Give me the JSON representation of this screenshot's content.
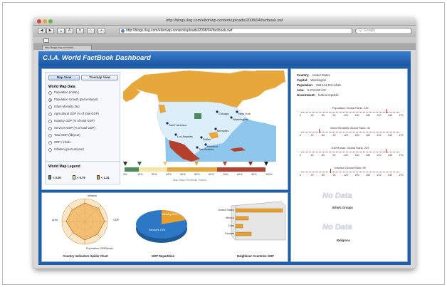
{
  "window": {
    "title": "http://blogs.ilog.com/elixir/wp-content/uploads/2008/04/factbook.swf",
    "url": "http://blogs.ilog.com/elixir/wp-content/uploads/2008/04/factbook.swf",
    "search_placeholder": "Google",
    "tab_label": "http://blogs.ilog.com/elixir/..."
  },
  "dashboard": {
    "title": "C.I.A. World FactBook Dashboard"
  },
  "controls": {
    "view_buttons": [
      "Map View",
      "Treemap View"
    ],
    "map_data_heading": "World Map Data",
    "map_data_options": [
      "Population (inhab.)",
      "Population Growth (percent/year)",
      "Infant Mortality (‰)",
      "Agricultural GDP (% of total GDP)",
      "Industry GDP (% of total GDP)",
      "Services GDP (% of total GDP)",
      "Total GDP (k$/year)",
      "GDP / inhab.",
      "Inflation (percent/year)"
    ],
    "selected_option": 1,
    "legend_heading": "World Map Legend",
    "legend_items": [
      {
        "label": "< 0.00",
        "color": "#3e8a4a"
      },
      {
        "label": "< 0.79",
        "color": "#f2e3a2"
      },
      {
        "label": "< 1.31",
        "color": "#e6a230"
      }
    ]
  },
  "map": {
    "city_labels": [
      "Chicago",
      "New York",
      "Washington",
      "San Francisco",
      "Memphis",
      "Los Angeles",
      "Dallas",
      "Houston",
      "San Antonio"
    ],
    "scale_ticks": [
      "0%",
      "10%",
      "20%",
      "30%",
      "40%",
      "50%",
      "60%",
      "70%",
      "80%",
      "90%",
      "100%"
    ],
    "scale_caption": "Map Data Percentile Portion",
    "colors": {
      "green": "#4b8d5a",
      "yellow": "#f4e7a6",
      "orange": "#e8a73a",
      "red": "#b5412d",
      "water": "#8fc7ec",
      "usa": "#dceef9"
    }
  },
  "charts": {
    "spider": {
      "title": "Country Indicators Spider Chart",
      "labels": [
        "Inflation",
        "GDP",
        "Population GDP/inhab.",
        "Area"
      ]
    },
    "pie": {
      "title": "GDP Repartition",
      "slices": [
        {
          "label": "Industry 20%",
          "value": 20,
          "color": "#e7a02f"
        },
        {
          "label": "Services 79%",
          "value": 79,
          "color": "#2c78c4"
        }
      ]
    },
    "bars": {
      "title": "Neighbour Countries GDP",
      "categories": [
        "United States",
        "Mexico",
        "Cuba",
        "Canada"
      ]
    }
  },
  "info": {
    "fields": [
      {
        "label": "Country:",
        "value": "United States"
      },
      {
        "label": "Capital:",
        "value": "Washington"
      },
      {
        "label": "Population:",
        "value": "298,444,215 inhab."
      },
      {
        "label": "Area:",
        "value": "9,372,610 km²"
      },
      {
        "label": "Government:",
        "value": "federal republic"
      }
    ],
    "ranks": [
      {
        "title": "Population Global Rank: 233",
        "position": 0.87
      },
      {
        "title": "Infant Mortality Global Rank: 40",
        "position": 0.18
      },
      {
        "title": "GDP/Inhab. Global Rank: 229",
        "position": 0.86
      },
      {
        "title": "Inflation Global Rank: 69",
        "position": 0.3
      }
    ],
    "rank_axis": [
      "0",
      "30",
      "60",
      "90",
      "120",
      "150",
      "180",
      "210",
      "240",
      "270"
    ],
    "nodata_text": "No Data",
    "nodata_captions": [
      "Ethnic Groups",
      "Religions"
    ]
  }
}
